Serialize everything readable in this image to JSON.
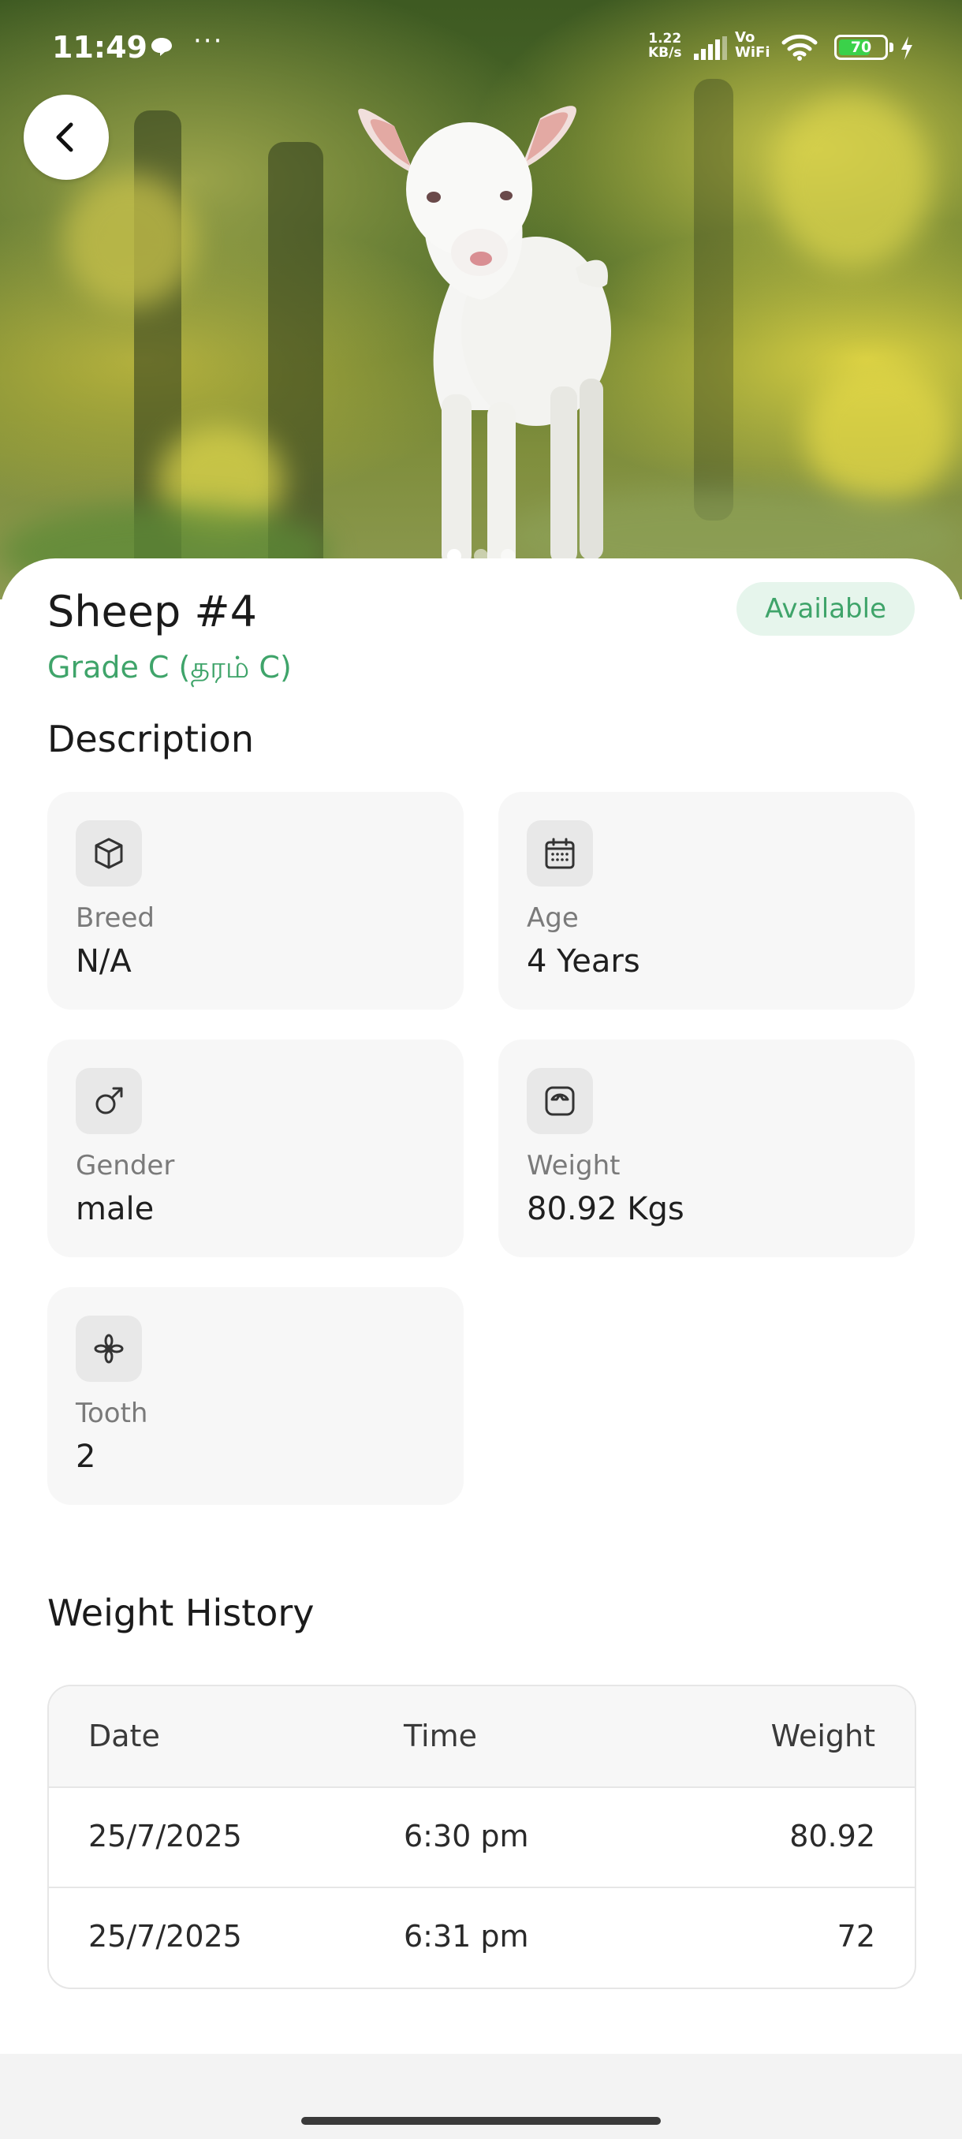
{
  "status_bar": {
    "time": "11:49",
    "more": "···",
    "net_speed_value": "1.22",
    "net_speed_unit": "KB/s",
    "vowifi_top": "Vo",
    "vowifi_bottom": "WiFi",
    "battery": "70",
    "battery_level": 0.7,
    "battery_color": "#3bd14a"
  },
  "hero": {
    "carousel_pages": 3,
    "active_page": 1
  },
  "animal": {
    "title": "Sheep #4",
    "grade": "Grade C (தரம் C)",
    "status": "Available"
  },
  "description": {
    "heading": "Description",
    "cards": [
      {
        "icon": "cube-icon",
        "label": "Breed",
        "value": "N/A"
      },
      {
        "icon": "calendar-icon",
        "label": "Age",
        "value": "4 Years"
      },
      {
        "icon": "male-icon",
        "label": "Gender",
        "value": "male"
      },
      {
        "icon": "scale-icon",
        "label": "Weight",
        "value": "80.92 Kgs"
      },
      {
        "icon": "tooth-icon",
        "label": "Tooth",
        "value": "2"
      }
    ]
  },
  "weight_history": {
    "heading": "Weight History",
    "columns": [
      "Date",
      "Time",
      "Weight"
    ],
    "rows": [
      {
        "date": "25/7/2025",
        "time": "6:30 pm",
        "weight": "80.92"
      },
      {
        "date": "25/7/2025",
        "time": "6:31 pm",
        "weight": "72"
      }
    ]
  },
  "colors": {
    "accent": "#3fa46a",
    "badge_bg": "#e6f5ec",
    "card_bg": "#f7f7f7"
  }
}
